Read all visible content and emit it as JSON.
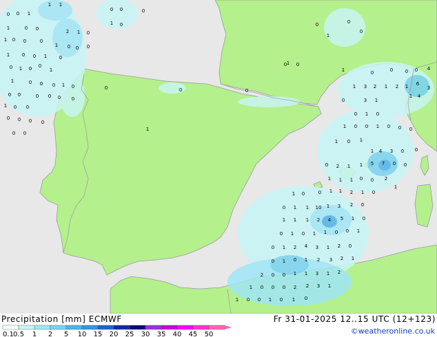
{
  "product": {
    "title": "Precipitation [mm]",
    "model": "ECMWF",
    "valid_time": "Fr 31-01-2025 12..15 UTC (12+123)",
    "credit": "©weatheronline.co.uk"
  },
  "colors": {
    "sea": "#e8e8e8",
    "land": "#b4f08c",
    "border": "#a0a0a0",
    "coast": "#9a9a9a"
  },
  "legend": {
    "ticks": [
      "0.1",
      "0.5",
      "1",
      "2",
      "5",
      "10",
      "15",
      "20",
      "25",
      "30",
      "35",
      "40",
      "45",
      "50"
    ],
    "colors": [
      "#f5fffa",
      "#c8f5f5",
      "#a0e6f5",
      "#78d2f0",
      "#50b4e6",
      "#3296dc",
      "#1e64c8",
      "#1428a0",
      "#0a0a6e",
      "#9632dc",
      "#c800dc",
      "#ff00ff",
      "#ff32c8",
      "#ff64b4"
    ]
  },
  "precip_values": [
    {
      "t": "1"
    },
    {
      "t": "0"
    },
    {
      "t": "1"
    },
    {
      "t": "0"
    },
    {
      "t": "0"
    },
    {
      "t": "1"
    },
    {
      "t": "0"
    },
    {
      "t": "0"
    },
    {
      "t": "1"
    },
    {
      "t": "0"
    },
    {
      "t": "2"
    },
    {
      "t": "1"
    },
    {
      "t": "0"
    },
    {
      "t": "0"
    },
    {
      "t": "1"
    },
    {
      "t": "0"
    },
    {
      "t": "0"
    },
    {
      "t": "1"
    },
    {
      "t": "0"
    },
    {
      "t": "0"
    },
    {
      "t": "1"
    },
    {
      "t": "0"
    },
    {
      "t": "0"
    },
    {
      "t": "0"
    },
    {
      "t": "1"
    },
    {
      "t": "0"
    },
    {
      "t": "0"
    },
    {
      "t": "1"
    },
    {
      "t": "0"
    },
    {
      "t": "0"
    },
    {
      "t": "0"
    },
    {
      "t": "1"
    },
    {
      "t": "0"
    },
    {
      "t": "1"
    },
    {
      "t": "1"
    },
    {
      "t": "0"
    },
    {
      "t": "0"
    },
    {
      "t": "0"
    },
    {
      "t": "1"
    },
    {
      "t": "0"
    },
    {
      "t": "0"
    },
    {
      "t": "0"
    },
    {
      "t": "0"
    },
    {
      "t": "0"
    },
    {
      "t": "0"
    },
    {
      "t": "0"
    },
    {
      "t": "1"
    },
    {
      "t": "0"
    },
    {
      "t": "0"
    },
    {
      "t": "0"
    },
    {
      "t": "0"
    },
    {
      "t": "0"
    },
    {
      "t": "0"
    },
    {
      "t": "0"
    },
    {
      "t": "0"
    },
    {
      "t": "1"
    },
    {
      "t": "0"
    },
    {
      "t": "0"
    },
    {
      "t": "0"
    },
    {
      "t": "0"
    },
    {
      "t": "0"
    },
    {
      "t": "1"
    },
    {
      "t": "0"
    },
    {
      "t": "0"
    },
    {
      "t": "0"
    },
    {
      "t": "1"
    },
    {
      "t": "1"
    },
    {
      "t": "0"
    },
    {
      "t": "0"
    },
    {
      "t": "0"
    },
    {
      "t": "0"
    },
    {
      "t": "4"
    },
    {
      "t": "1"
    },
    {
      "t": "3"
    },
    {
      "t": "2"
    },
    {
      "t": "1"
    },
    {
      "t": "2"
    },
    {
      "t": "1"
    },
    {
      "t": "6"
    },
    {
      "t": "3"
    },
    {
      "t": "0"
    },
    {
      "t": "3"
    },
    {
      "t": "1"
    },
    {
      "t": "1"
    },
    {
      "t": "4"
    },
    {
      "t": "0"
    },
    {
      "t": "1"
    },
    {
      "t": "0"
    },
    {
      "t": "1"
    },
    {
      "t": "0"
    },
    {
      "t": "0"
    },
    {
      "t": "1"
    },
    {
      "t": "0"
    },
    {
      "t": "0"
    },
    {
      "t": "0"
    },
    {
      "t": "1"
    },
    {
      "t": "0"
    },
    {
      "t": "1"
    },
    {
      "t": "1"
    },
    {
      "t": "4"
    },
    {
      "t": "3"
    },
    {
      "t": "0"
    },
    {
      "t": "0"
    },
    {
      "t": "0"
    },
    {
      "t": "2"
    },
    {
      "t": "1"
    },
    {
      "t": "1"
    },
    {
      "t": "5"
    },
    {
      "t": "7"
    },
    {
      "t": "0"
    },
    {
      "t": "0"
    },
    {
      "t": "1"
    },
    {
      "t": "1"
    },
    {
      "t": "1"
    },
    {
      "t": "0"
    },
    {
      "t": "0"
    },
    {
      "t": "2"
    },
    {
      "t": "1"
    },
    {
      "t": "1"
    },
    {
      "t": "0"
    },
    {
      "t": "0"
    },
    {
      "t": "1"
    },
    {
      "t": "1"
    },
    {
      "t": "2"
    },
    {
      "t": "1"
    },
    {
      "t": "0"
    },
    {
      "t": "0"
    },
    {
      "t": "1"
    },
    {
      "t": "1"
    },
    {
      "t": "10"
    },
    {
      "t": "1"
    },
    {
      "t": "3"
    },
    {
      "t": "2"
    },
    {
      "t": "0"
    },
    {
      "t": "1"
    },
    {
      "t": "1"
    },
    {
      "t": "1"
    },
    {
      "t": "2"
    },
    {
      "t": "4"
    },
    {
      "t": "5"
    },
    {
      "t": "1"
    },
    {
      "t": "0"
    },
    {
      "t": "0"
    },
    {
      "t": "1"
    },
    {
      "t": "0"
    },
    {
      "t": "1"
    },
    {
      "t": "1"
    },
    {
      "t": "0"
    },
    {
      "t": "0"
    },
    {
      "t": "1"
    },
    {
      "t": "0"
    },
    {
      "t": "1"
    },
    {
      "t": "2"
    },
    {
      "t": "4"
    },
    {
      "t": "3"
    },
    {
      "t": "1"
    },
    {
      "t": "2"
    },
    {
      "t": "0"
    },
    {
      "t": "0"
    },
    {
      "t": "1"
    },
    {
      "t": "0"
    },
    {
      "t": "1"
    },
    {
      "t": "2"
    },
    {
      "t": "3"
    },
    {
      "t": "2"
    },
    {
      "t": "1"
    },
    {
      "t": "2"
    },
    {
      "t": "0"
    },
    {
      "t": "0"
    },
    {
      "t": "1"
    },
    {
      "t": "1"
    },
    {
      "t": "3"
    },
    {
      "t": "1"
    },
    {
      "t": "2"
    },
    {
      "t": "1"
    },
    {
      "t": "0"
    },
    {
      "t": "0"
    },
    {
      "t": "0"
    },
    {
      "t": "2"
    },
    {
      "t": "2"
    },
    {
      "t": "3"
    },
    {
      "t": "1"
    },
    {
      "t": "1"
    },
    {
      "t": "0"
    },
    {
      "t": "0"
    },
    {
      "t": "1"
    },
    {
      "t": "0"
    },
    {
      "t": "1"
    },
    {
      "t": "0"
    },
    {
      "t": "0"
    },
    {
      "t": "0"
    }
  ]
}
